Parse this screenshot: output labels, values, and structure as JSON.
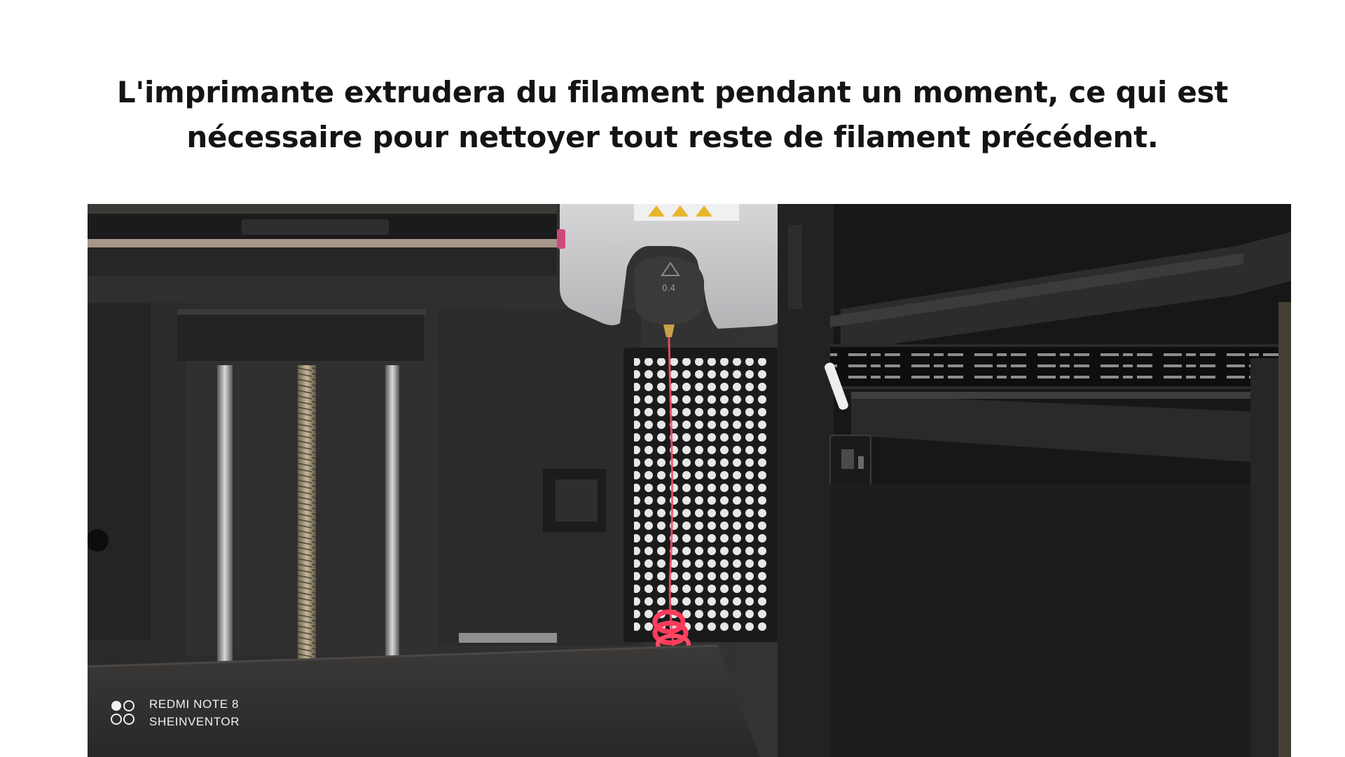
{
  "caption": {
    "line1": "L'imprimante extrudera du filament pendant un moment, ce qui est",
    "line2": "nécessaire pour nettoyer tout reste de filament précédent."
  },
  "photo": {
    "nozzle_size_label": "0.4",
    "watermark": {
      "device": "REDMI NOTE 8",
      "author": "SHEINVENTOR"
    },
    "colors": {
      "filament": "#f2506a",
      "toolhead": "#c9c9cb",
      "frame": "#222222"
    }
  }
}
